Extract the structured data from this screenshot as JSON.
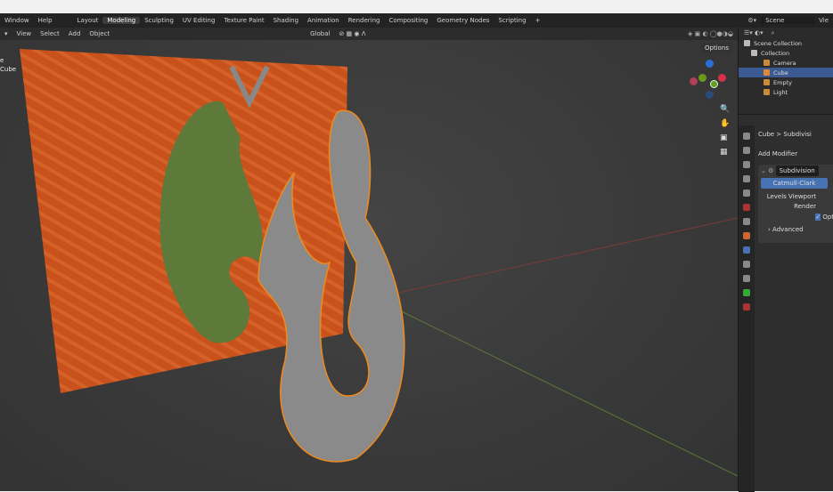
{
  "menu": [
    "Window",
    "Help"
  ],
  "workspaces": [
    "Layout",
    "Modeling",
    "Sculpting",
    "UV Editing",
    "Texture Paint",
    "Shading",
    "Animation",
    "Rendering",
    "Compositing",
    "Geometry Nodes",
    "Scripting",
    "+"
  ],
  "active_workspace": "Modeling",
  "scene": {
    "label": "Scene",
    "view_layer": "Vie"
  },
  "header": {
    "items": [
      "View",
      "Select",
      "Add",
      "Object"
    ],
    "transform": "Global",
    "options": "Options"
  },
  "overlay_text": {
    "line1": "e",
    "line2": "Cube"
  },
  "outliner": {
    "root": "Scene Collection",
    "collection": "Collection",
    "items": [
      {
        "name": "Camera",
        "color": "#c98a3a"
      },
      {
        "name": "Cube",
        "color": "#e08a3a",
        "selected": true
      },
      {
        "name": "Empty",
        "color": "#c98a3a"
      },
      {
        "name": "Light",
        "color": "#c98a3a"
      }
    ]
  },
  "properties": {
    "breadcrumb_object": "Cube",
    "breadcrumb_modifier": "Subdivisi",
    "add_modifier": "Add Modifier",
    "modifier_name": "Subdivision",
    "mode": "Catmull-Clark",
    "levels_viewport": "Levels Viewport",
    "render": "Render",
    "optimal": "Opti",
    "advanced": "Advanced"
  },
  "colors": {
    "accent": "#4772b3",
    "selection_outline": "#f08a1c"
  }
}
